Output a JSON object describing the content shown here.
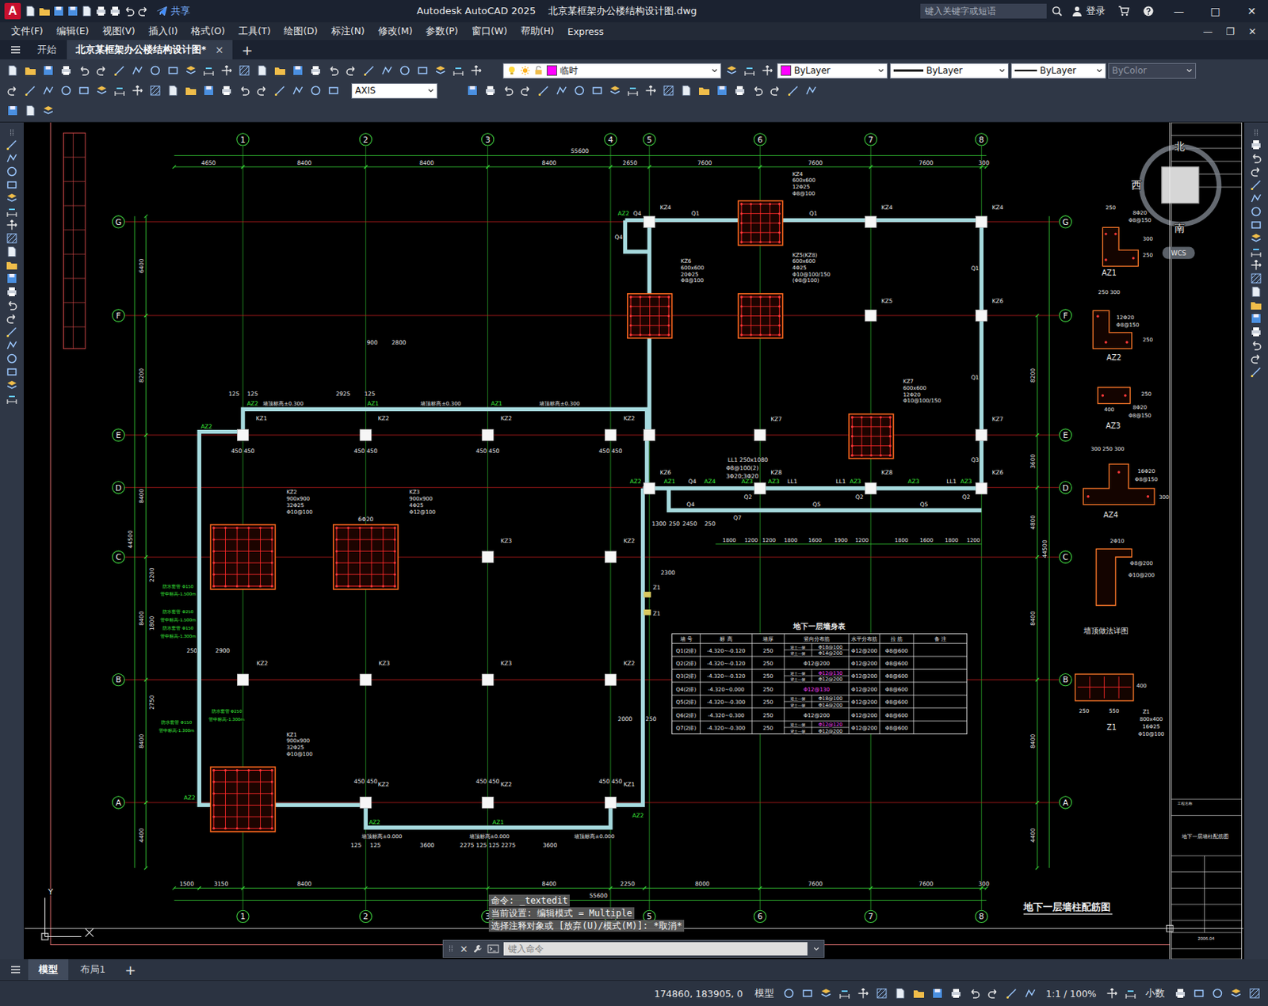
{
  "window": {
    "app_icon": "A",
    "share": "共享",
    "title": "Autodesk AutoCAD 2025    北京某框架办公楼结构设计图.dwg",
    "search_placeholder": "键入关键字或短语",
    "login": "登录",
    "controls": [
      "—",
      "□",
      "✕"
    ]
  },
  "menu": {
    "items": [
      "文件(F)",
      "编辑(E)",
      "视图(V)",
      "插入(I)",
      "格式(O)",
      "工具(T)",
      "绘图(D)",
      "标注(N)",
      "修改(M)",
      "参数(P)",
      "窗口(W)",
      "帮助(H)",
      "Express"
    ],
    "doc_controls": [
      "—",
      "❐",
      "✕"
    ]
  },
  "doc_tabs": {
    "tabs": [
      {
        "label": "开始",
        "selected": false,
        "closable": false
      },
      {
        "label": "北京某框架办公楼结构设计图*",
        "selected": true,
        "closable": true
      }
    ],
    "close": "×",
    "new": "+"
  },
  "properties": {
    "layer": "临时",
    "color": "ByLayer",
    "linetype": "ByLayer",
    "lineweight": "ByLayer",
    "plot_style": "ByColor",
    "plot_style_disabled": true,
    "dim_style": "AXIS"
  },
  "drawing": {
    "axis_cols": [
      "1",
      "2",
      "3",
      "4",
      "5",
      "6",
      "7",
      "8"
    ],
    "axis_rows": [
      "G",
      "F",
      "E",
      "D",
      "C",
      "B",
      "A"
    ],
    "top_total": "55600",
    "top_dims": [
      "4650",
      "8400",
      "8400",
      "8400",
      "2650",
      "7600",
      "7600",
      "7600",
      "300"
    ],
    "bottom_total": "55600",
    "bottom_dims": [
      "1500",
      "3150",
      "8400",
      "8400",
      "2250",
      "8000",
      "7600",
      "7600",
      "300"
    ],
    "left_total": "44500",
    "left_dims": [
      "6400",
      "8200",
      "8400",
      "8400",
      "8400",
      "4400"
    ],
    "right_total": "44500",
    "right_dims": [
      "8200",
      "3600",
      "4800",
      "8400",
      "8400",
      "4400"
    ],
    "big_columns": [
      {
        "lines": [
          "KZ2",
          "900x900",
          "32Φ25",
          "Φ10@100"
        ]
      },
      {
        "lines": [
          "KZ3",
          "900x900",
          "4Φ25",
          "Φ12@100"
        ]
      },
      {
        "lines": [
          "KZ1",
          "900x900",
          "32Φ25",
          "Φ10@100"
        ]
      },
      {
        "lines": [
          "KZ4",
          "600x600",
          "12Φ25",
          "Φ8@100"
        ]
      },
      {
        "lines": [
          "KZ6",
          "600x600",
          "20Φ25",
          "Φ8@100"
        ]
      },
      {
        "lines": [
          "KZ5(KZ8)",
          "600x600",
          "4Φ25",
          "Φ10@100/150",
          "(Φ8@100)"
        ]
      },
      {
        "lines": [
          "KZ7",
          "600x600",
          "12Φ20",
          "Φ10@100/150"
        ]
      }
    ],
    "d_dims": [
      "1800",
      "1200",
      "1200",
      "1800",
      "1600",
      "1900",
      "1200",
      "1800",
      "1600",
      "1800",
      "1200"
    ],
    "plan_labels": [
      "墙顶标高±0.300",
      "墙顶标高±0.300",
      "墙顶标高±0.300",
      "AZ2",
      "AZ1",
      "AZ1",
      "125",
      "125",
      "2925",
      "125",
      "900",
      "2800",
      "KZ1",
      "KZ2",
      "KZ2",
      "KZ2",
      "450 450",
      "450 450",
      "450 450",
      "450 450",
      "AZ2",
      "KZ3",
      "KZ2",
      "KZ2",
      "KZ3",
      "KZ3",
      "KZ2",
      "KZ2",
      "KZ2",
      "KZ1",
      "KZ4",
      "KZ4",
      "KZ4",
      "KZ5",
      "KZ6",
      "KZ7",
      "KZ7",
      "KZ6",
      "KZ8",
      "KZ8",
      "KZ6",
      "Q1",
      "Q1",
      "Q4",
      "Q4",
      "Q1",
      "Q1",
      "Q3",
      "Q4",
      "Q4",
      "Q5",
      "Q5",
      "Q2",
      "Q7",
      "Q2",
      "Q2",
      "AZ2",
      "AZ2",
      "AZ1",
      "AZ4",
      "AZ3",
      "AZ3",
      "AZ3",
      "AZ3",
      "AZ3",
      "LL1",
      "LL1",
      "LL1",
      "LL1  250x1080",
      "Φ8@100(2)",
      "3Φ20;3Φ20",
      "2200",
      "1800",
      "2900",
      "2750",
      "250",
      "防水套管 Φ150",
      "管中标高-1.500m",
      "防水套管 Φ250",
      "管中标高-1.500m",
      "防水套管 Φ150",
      "管中标高-1.300m",
      "防水套管 Φ250",
      "管中标高-1.300m",
      "防水套管 Φ150",
      "管中标高-1.300m",
      "墙顶标高±0.000",
      "墙顶标高±0.000",
      "墙顶标高±0.000",
      "3600",
      "2275 125 125 2275",
      "3600",
      "125",
      "125",
      "AZ2",
      "AZ1",
      "AZ2",
      "AZ2",
      "450 450",
      "450 450",
      "450 450",
      "2000",
      "250",
      "Z1",
      "Z1",
      "2300",
      "6Φ20",
      "1300",
      "250",
      "2450",
      "250"
    ],
    "detail_labels": [
      "250",
      "8Φ20",
      "Φ8@150",
      "300",
      "250",
      "AZ1",
      "250  300",
      "12Φ20",
      "Φ8@150",
      "250",
      "AZ2",
      "250",
      "400",
      "8Φ20",
      "Φ8@150",
      "AZ3",
      "300  250  300",
      "16Φ20",
      "Φ8@150",
      "300",
      "AZ4",
      "2Φ10",
      "Φ8@200",
      "Φ10@200",
      "墙顶做法详图",
      "400",
      "250",
      "550",
      "Z1",
      "800x400",
      "16Φ25",
      "Φ10@100",
      "Z1"
    ],
    "schedule": {
      "title": "地下一层墙身表",
      "headers": [
        "墙 号",
        "标 高",
        "墙厚",
        "竖向分布筋",
        "水平分布筋",
        "拉 筋",
        "备 注"
      ],
      "rows": [
        {
          "wall": "Q1(2排)",
          "elevation": "-4.320~-0.120",
          "thickness": "250",
          "vertical": [
            {
              "side": "迎土一侧",
              "bar": "Φ18@100",
              "highlight": false
            },
            {
              "side": "背土一侧",
              "bar": "Φ14@200",
              "highlight": false
            }
          ],
          "horizontal": "Φ12@200",
          "tie": "Φ8@600"
        },
        {
          "wall": "Q2(2排)",
          "elevation": "-4.320~-0.120",
          "thickness": "250",
          "vertical": [
            {
              "side": "",
              "bar": "Φ12@200",
              "highlight": false
            }
          ],
          "horizontal": "Φ12@200",
          "tie": "Φ8@600"
        },
        {
          "wall": "Q3(2排)",
          "elevation": "-4.320~-0.120",
          "thickness": "250",
          "vertical": [
            {
              "side": "迎土一侧",
              "bar": "Φ12@130",
              "highlight": true
            },
            {
              "side": "背土一侧",
              "bar": "Φ12@200",
              "highlight": false
            }
          ],
          "horizontal": "Φ12@200",
          "tie": "Φ8@600"
        },
        {
          "wall": "Q4(2排)",
          "elevation": "-4.320~0.000",
          "thickness": "250",
          "vertical": [
            {
              "side": "",
              "bar": "Φ12@130",
              "highlight": true
            }
          ],
          "horizontal": "Φ12@200",
          "tie": "Φ8@600"
        },
        {
          "wall": "Q5(2排)",
          "elevation": "-4.320~-0.300",
          "thickness": "250",
          "vertical": [
            {
              "side": "迎土一侧",
              "bar": "Φ18@100",
              "highlight": false
            },
            {
              "side": "背土一侧",
              "bar": "Φ14@200",
              "highlight": false
            }
          ],
          "horizontal": "Φ12@200",
          "tie": "Φ8@600"
        },
        {
          "wall": "Q6(2排)",
          "elevation": "-4.320~0.300",
          "thickness": "250",
          "vertical": [
            {
              "side": "",
              "bar": "Φ12@200",
              "highlight": false
            }
          ],
          "horizontal": "Φ12@200",
          "tie": "Φ8@600"
        },
        {
          "wall": "Q7(2排)",
          "elevation": "-4.320~-0.300",
          "thickness": "250",
          "vertical": [
            {
              "side": "迎土一侧",
              "bar": "Φ12@120",
              "highlight": true
            },
            {
              "side": "背土一侧",
              "bar": "Φ12@200",
              "highlight": false
            }
          ],
          "horizontal": "Φ12@200",
          "tie": "Φ8@600"
        }
      ]
    },
    "title_block": [
      "工程名称",
      "地下一层墙柱配筋图",
      "2006.04"
    ],
    "sheet_title": "地下一层墙柱配筋图"
  },
  "viewcube": {
    "north": "北",
    "west": "西",
    "south": "南",
    "wcs": "WCS"
  },
  "ucs": {
    "y": "Y"
  },
  "command": {
    "history": [
      "命令: _textedit",
      "当前设置: 编辑模式 = Multiple",
      "选择注释对象或 [放弃(U)/模式(M)]: *取消*"
    ],
    "close": "✕",
    "placeholder": "键入命令"
  },
  "layout_tabs": {
    "tabs": [
      {
        "label": "模型",
        "selected": true
      },
      {
        "label": "布局1",
        "selected": false
      }
    ],
    "new": "+"
  },
  "status_bar": {
    "coords": "174860, 183905, 0",
    "space": "模型",
    "scale": "1:1 / 100%",
    "units": "小数"
  }
}
